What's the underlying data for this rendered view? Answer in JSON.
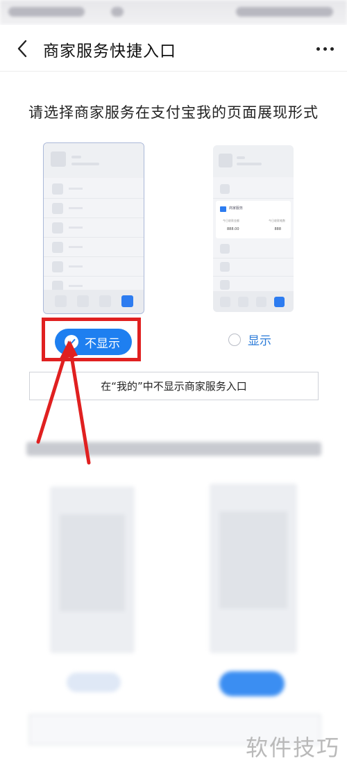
{
  "navbar": {
    "title": "商家服务快捷入口"
  },
  "section1": {
    "title": "请选择商家服务在支付宝我的页面展现形式",
    "option_hide_label": "不显示",
    "option_show_label": "显示",
    "selected": "不显示",
    "description": "在“我的”中不显示商家服务入口"
  },
  "preview_show": {
    "card_title": "商家服务",
    "left_label": "今日收款金额",
    "left_value": "888.00",
    "right_label": "今日收款笔数",
    "right_value": "888"
  },
  "watermark": "软件技巧",
  "colors": {
    "accent": "#1e7ff0",
    "highlight": "#e02020"
  }
}
